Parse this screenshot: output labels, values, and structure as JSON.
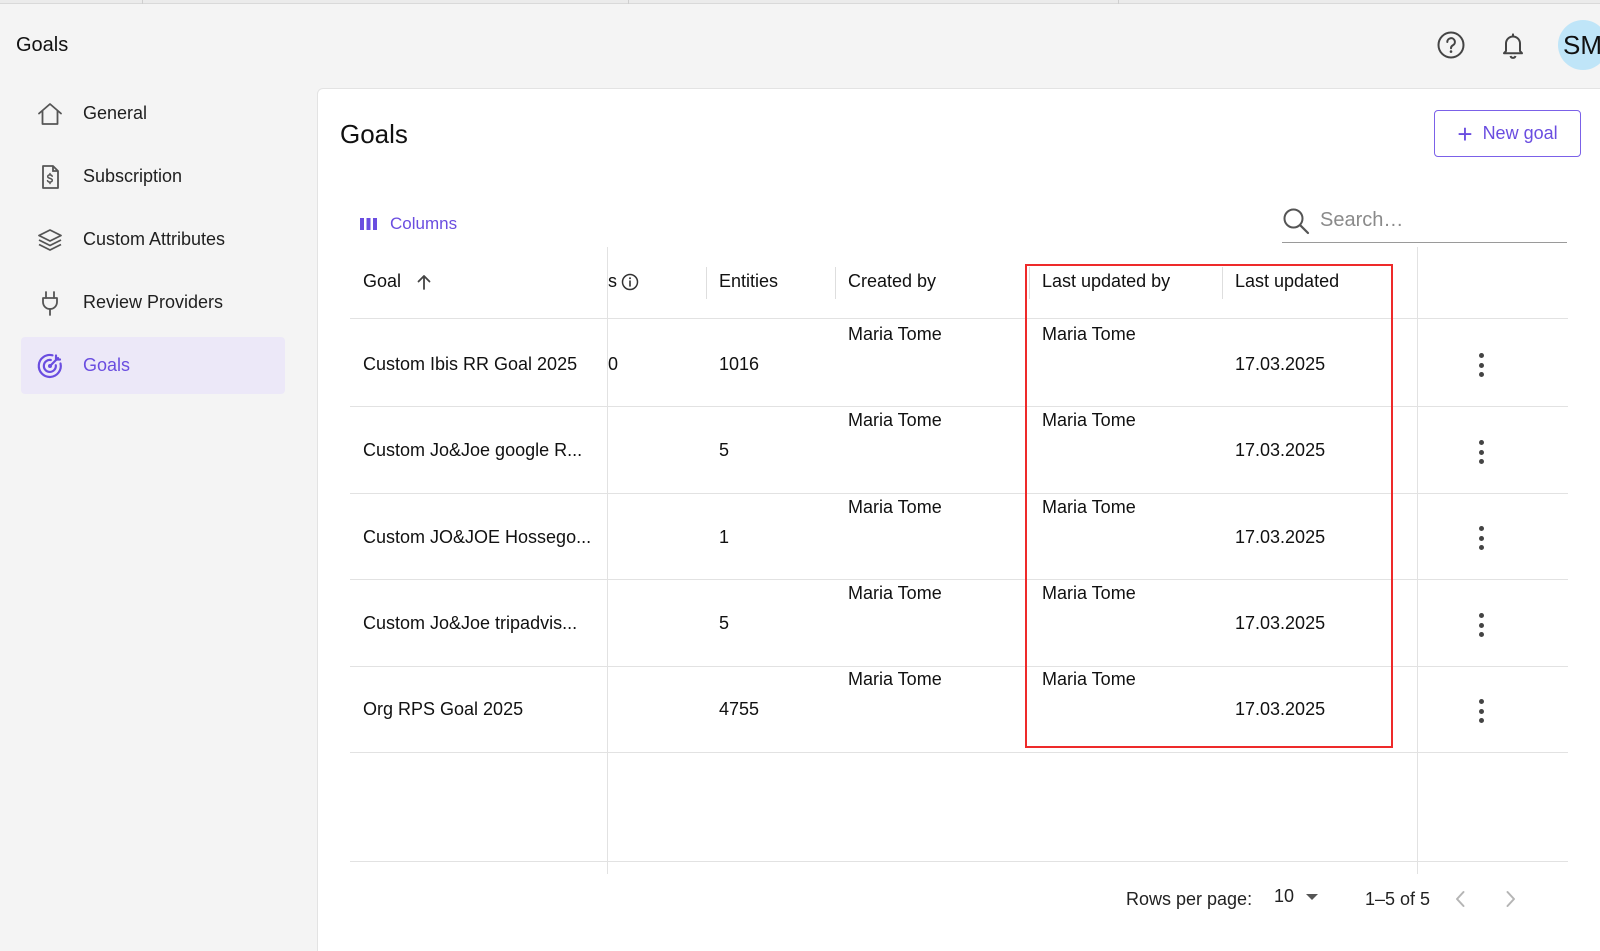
{
  "app": {
    "title": "Goals"
  },
  "header": {
    "avatar_initials": "SM",
    "help_icon": "help-circle-icon",
    "bell_icon": "bell-icon"
  },
  "sidebar": {
    "items": [
      {
        "label": "General",
        "icon": "home-icon",
        "active": false
      },
      {
        "label": "Subscription",
        "icon": "invoice-icon",
        "active": false
      },
      {
        "label": "Custom Attributes",
        "icon": "layers-icon",
        "active": false
      },
      {
        "label": "Review Providers",
        "icon": "plug-icon",
        "active": false
      },
      {
        "label": "Goals",
        "icon": "target-icon",
        "active": true
      }
    ]
  },
  "main": {
    "title": "Goals",
    "new_goal_label": "New goal",
    "columns_label": "Columns",
    "search_placeholder": "Search…",
    "table": {
      "headers": {
        "goal": "Goal",
        "partial": "s",
        "entities": "Entities",
        "created_by": "Created by",
        "last_updated_by": "Last updated by",
        "last_updated": "Last updated"
      },
      "rows": [
        {
          "goal": "Custom Ibis RR Goal 2025",
          "partial": "0",
          "entities": "1016",
          "created_by": "Maria Tome",
          "last_updated_by": "Maria Tome",
          "last_updated": "17.03.2025"
        },
        {
          "goal": "Custom Jo&Joe google R...",
          "partial": "",
          "entities": "5",
          "created_by": "Maria Tome",
          "last_updated_by": "Maria Tome",
          "last_updated": "17.03.2025"
        },
        {
          "goal": "Custom JO&JOE Hossego...",
          "partial": "",
          "entities": "1",
          "created_by": "Maria Tome",
          "last_updated_by": "Maria Tome",
          "last_updated": "17.03.2025"
        },
        {
          "goal": "Custom Jo&Joe tripadvis...",
          "partial": "",
          "entities": "5",
          "created_by": "Maria Tome",
          "last_updated_by": "Maria Tome",
          "last_updated": "17.03.2025"
        },
        {
          "goal": "Org RPS Goal 2025",
          "partial": "",
          "entities": "4755",
          "created_by": "Maria Tome",
          "last_updated_by": "Maria Tome",
          "last_updated": "17.03.2025"
        }
      ]
    },
    "pagination": {
      "rows_per_page_label": "Rows per page:",
      "rows_per_page_value": "10",
      "range": "1–5 of 5"
    }
  },
  "colors": {
    "accent": "#6a4de0",
    "highlight": "#ee2a2a"
  }
}
